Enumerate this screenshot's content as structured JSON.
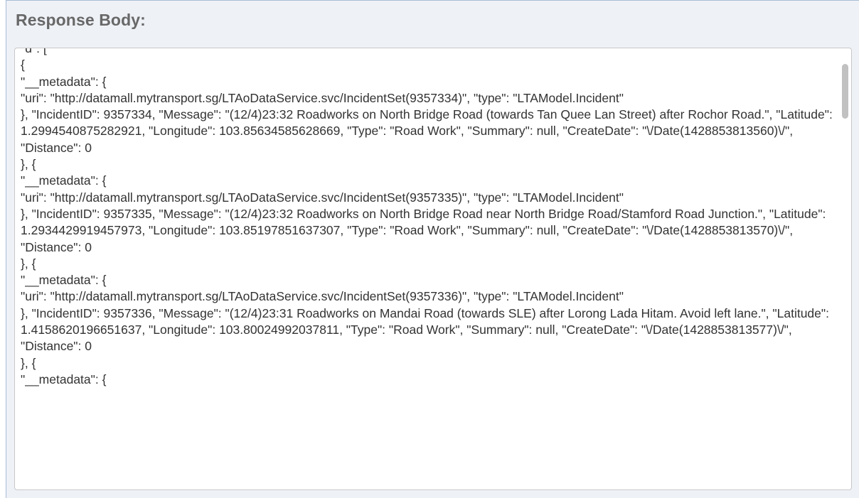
{
  "panel": {
    "title": "Response Body:"
  },
  "response": {
    "text": "\"d\": [\n{\n\"__metadata\": {\n\"uri\": \"http://datamall.mytransport.sg/LTAoDataService.svc/IncidentSet(9357334)\", \"type\": \"LTAModel.Incident\"\n}, \"IncidentID\": 9357334, \"Message\": \"(12/4)23:32 Roadworks on North Bridge Road (towards Tan Quee Lan Street) after Rochor Road.\", \"Latitude\": 1.2994540875282921, \"Longitude\": 103.85634585628669, \"Type\": \"Road Work\", \"Summary\": null, \"CreateDate\": \"\\/Date(1428853813560)\\/\", \"Distance\": 0\n}, {\n\"__metadata\": {\n\"uri\": \"http://datamall.mytransport.sg/LTAoDataService.svc/IncidentSet(9357335)\", \"type\": \"LTAModel.Incident\"\n}, \"IncidentID\": 9357335, \"Message\": \"(12/4)23:32 Roadworks on North Bridge Road near North Bridge Road/Stamford Road Junction.\", \"Latitude\": 1.2934429919457973, \"Longitude\": 103.85197851637307, \"Type\": \"Road Work\", \"Summary\": null, \"CreateDate\": \"\\/Date(1428853813570)\\/\", \"Distance\": 0\n}, {\n\"__metadata\": {\n\"uri\": \"http://datamall.mytransport.sg/LTAoDataService.svc/IncidentSet(9357336)\", \"type\": \"LTAModel.Incident\"\n}, \"IncidentID\": 9357336, \"Message\": \"(12/4)23:31 Roadworks on Mandai Road (towards SLE) after Lorong Lada Hitam. Avoid left lane.\", \"Latitude\": 1.4158620196651637, \"Longitude\": 103.80024992037811, \"Type\": \"Road Work\", \"Summary\": null, \"CreateDate\": \"\\/Date(1428853813577)\\/\", \"Distance\": 0\n}, {\n\"__metadata\": {"
  },
  "colors": {
    "panel_background": "#eef1f6",
    "panel_border": "#a9bdd6",
    "title_text": "#686868",
    "body_text": "#333333"
  }
}
